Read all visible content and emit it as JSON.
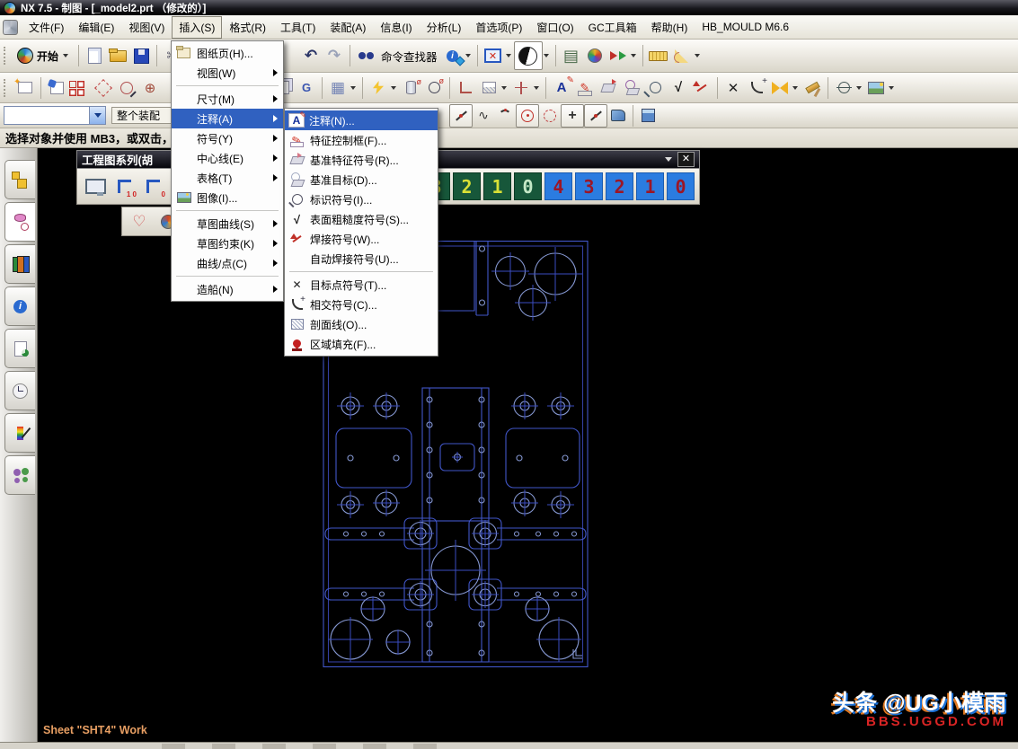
{
  "window": {
    "title": "NX 7.5 - 制图 - [_model2.prt （修改的）]"
  },
  "menu_bar": {
    "items": [
      {
        "label": "文件(F)"
      },
      {
        "label": "编辑(E)"
      },
      {
        "label": "视图(V)"
      },
      {
        "label": "插入(S)",
        "pressed": true
      },
      {
        "label": "格式(R)"
      },
      {
        "label": "工具(T)"
      },
      {
        "label": "装配(A)"
      },
      {
        "label": "信息(I)"
      },
      {
        "label": "分析(L)"
      },
      {
        "label": "首选项(P)"
      },
      {
        "label": "窗口(O)"
      },
      {
        "label": "GC工具箱"
      },
      {
        "label": "帮助(H)"
      },
      {
        "label": "HB_MOULD M6.6"
      }
    ]
  },
  "toolbar_standard": {
    "start_label": "开始",
    "command_finder_label": "命令查找器",
    "icons": [
      "nx-logo",
      "new-file",
      "open",
      "save",
      "cut",
      "undo",
      "redo",
      "binoculars",
      "info-cascade",
      "window-close",
      "display-mode",
      "layer-settings",
      "object-display",
      "show-hide-arrows",
      "measure-distance",
      "measure-angle"
    ]
  },
  "toolbar_drafting": {
    "icons": [
      "new-sheet",
      "base-view",
      "projected-view",
      "detail-view",
      "section-view",
      "view-rotate",
      "sheet-copy",
      "gc-tool",
      "grid",
      "rapid-dimension",
      "cylinder-dimension",
      "hole-dimension",
      "corner",
      "section-line",
      "centerline",
      "note",
      "feature-control-frame",
      "datum-feature",
      "datum-target",
      "id-symbol",
      "surface-finish",
      "weld-symbol",
      "target-point",
      "intersection-symbol",
      "custom-symbol",
      "hammer",
      "crosshair-target",
      "image"
    ]
  },
  "toolbar_selection": {
    "filter_value": "",
    "scope_value": "整个装配",
    "icons": [
      "line",
      "studio-spline",
      "arc-3pt",
      "circle-center",
      "circle-dashed",
      "point",
      "line-2",
      "face",
      "cube"
    ]
  },
  "prompt_bar": {
    "text": "选择对象并使用 MB3，或双击，"
  },
  "insert_menu": {
    "items": [
      {
        "label": "图纸页(H)...",
        "icon": "sheet-icon"
      },
      {
        "label": "视图(W)",
        "submenu": true
      },
      {
        "label": "尺寸(M)",
        "submenu": true
      },
      {
        "label": "注释(A)",
        "submenu": true,
        "highlighted": true
      },
      {
        "label": "符号(Y)",
        "submenu": true
      },
      {
        "label": "中心线(E)",
        "submenu": true
      },
      {
        "label": "表格(T)",
        "submenu": true
      },
      {
        "label": "图像(I)...",
        "icon": "image-icon"
      },
      {
        "label": "草图曲线(S)",
        "submenu": true
      },
      {
        "label": "草图约束(K)",
        "submenu": true
      },
      {
        "label": "曲线/点(C)",
        "submenu": true
      },
      {
        "label": "造船(N)",
        "submenu": true
      }
    ]
  },
  "annotation_submenu": {
    "items": [
      {
        "label": "注释(N)...",
        "icon": "note-icon",
        "highlighted": true
      },
      {
        "label": "特征控制框(F)...",
        "icon": "feature-control-frame-icon"
      },
      {
        "label": "基准特征符号(R)...",
        "icon": "datum-feature-icon"
      },
      {
        "label": "基准目标(D)...",
        "icon": "datum-target-icon"
      },
      {
        "label": "标识符号(I)...",
        "icon": "id-symbol-icon"
      },
      {
        "label": "表面粗糙度符号(S)...",
        "icon": "surface-finish-icon"
      },
      {
        "label": "焊接符号(W)...",
        "icon": "weld-icon"
      },
      {
        "label": "自动焊接符号(U)..."
      },
      {
        "label": "目标点符号(T)...",
        "icon": "target-point-icon"
      },
      {
        "label": "相交符号(C)...",
        "icon": "intersection-icon"
      },
      {
        "label": "剖面线(O)...",
        "icon": "crosshatch-icon"
      },
      {
        "label": "区域填充(F)...",
        "icon": "area-fill-icon"
      }
    ]
  },
  "series_toolbar": {
    "title": "工程图系列(胡",
    "corner_digits": [
      "1 0",
      "0"
    ],
    "green_buttons": [
      "3",
      "2",
      "1",
      "0"
    ],
    "blue_buttons": [
      "4",
      "3",
      "2",
      "1",
      "0"
    ],
    "green_bg": "#17573a",
    "green_fg": "#d9e036",
    "blue_bg": "#2b7ce0",
    "blue_fg": "#9c1626"
  },
  "resource_bar": {
    "icons": [
      "assembly-navigator",
      "part-navigator",
      "library",
      "internet-browser",
      "report",
      "history",
      "visualization",
      "roles"
    ]
  },
  "canvas": {
    "sheet_status": "Sheet \"SHT4\" Work",
    "line_color": "#4156c8",
    "circle_color": "#8496d0",
    "background": "#000000"
  },
  "watermark": {
    "line1": "头条 @UG小模雨",
    "line2": "BBS.UGGD.COM"
  }
}
